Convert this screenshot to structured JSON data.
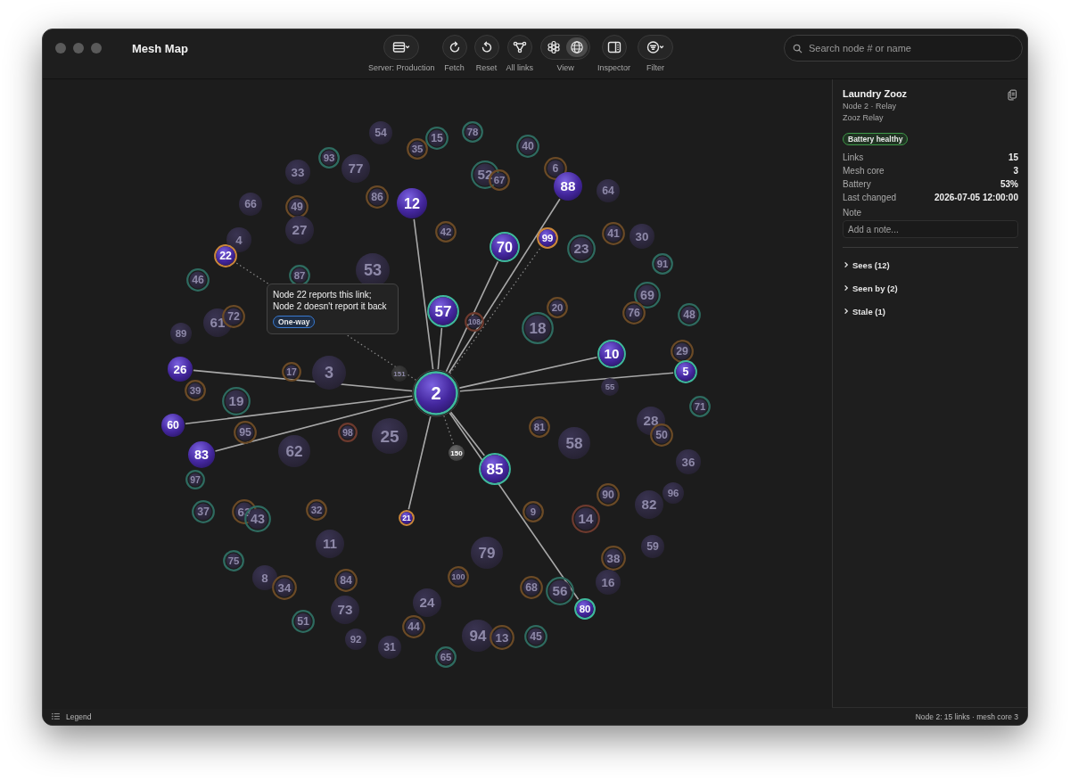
{
  "window": {
    "title": "Mesh Map"
  },
  "toolbar": {
    "items": [
      {
        "kind": "menu",
        "label": "Server: Production"
      },
      {
        "kind": "button",
        "label": "Fetch"
      },
      {
        "kind": "button",
        "label": "Reset"
      },
      {
        "kind": "button",
        "label": "All links"
      },
      {
        "kind": "segmented",
        "label": "View",
        "segments": [
          {
            "selected": false
          },
          {
            "selected": true
          }
        ]
      },
      {
        "kind": "button",
        "label": "Inspector"
      },
      {
        "kind": "menu",
        "label": "Filter"
      }
    ],
    "search": {
      "placeholder": "Search node # or name"
    }
  },
  "graph": {
    "nodes": [
      {
        "label": "78",
        "color": "#2e6b60",
        "offline": false,
        "selected": false
      },
      {
        "label": "54",
        "offline": false,
        "selected": false
      },
      {
        "label": "15",
        "color": "#2e6b60",
        "offline": false,
        "selected": false
      },
      {
        "label": "40",
        "color": "#2e6b60",
        "offline": false,
        "selected": false
      },
      {
        "label": "35",
        "color": "#6b4a26",
        "offline": false,
        "selected": false
      },
      {
        "label": "93",
        "color": "#2e6b60",
        "offline": false,
        "selected": false
      },
      {
        "label": "77",
        "offline": false,
        "selected": false
      },
      {
        "label": "6",
        "color": "#6b4a26",
        "offline": false,
        "selected": false
      },
      {
        "label": "33",
        "offline": false,
        "selected": false
      },
      {
        "label": "52",
        "color": "#2e6b60",
        "offline": false,
        "selected": false
      },
      {
        "label": "67",
        "color": "#6b4a26",
        "offline": false,
        "selected": false
      },
      {
        "label": "66",
        "offline": false,
        "selected": false
      },
      {
        "label": "49",
        "color": "#6b4a26",
        "offline": false,
        "selected": false
      },
      {
        "label": "86",
        "color": "#6b4a26",
        "offline": false,
        "selected": false
      },
      {
        "label": "12",
        "link": {
          "one_way": false
        },
        "offline": false,
        "selected": false
      },
      {
        "label": "88",
        "link": {
          "one_way": false
        },
        "offline": false,
        "selected": false
      },
      {
        "label": "64",
        "offline": false,
        "selected": false
      },
      {
        "label": "4",
        "offline": false,
        "selected": false
      },
      {
        "label": "27",
        "offline": false,
        "selected": false
      },
      {
        "label": "42",
        "color": "#6b4a26",
        "offline": false,
        "selected": false
      },
      {
        "label": "22",
        "color": "#c9863a",
        "link": {
          "one_way": true
        },
        "offline": false,
        "selected": false
      },
      {
        "label": "70",
        "color": "#3fb89c",
        "link": {
          "one_way": false
        },
        "offline": false,
        "selected": false
      },
      {
        "label": "99",
        "color": "#c9863a",
        "link": {
          "one_way": true
        },
        "offline": false,
        "selected": false
      },
      {
        "label": "23",
        "color": "#2e6b60",
        "offline": false,
        "selected": false
      },
      {
        "label": "41",
        "color": "#6b4a26",
        "offline": false,
        "selected": false
      },
      {
        "label": "30",
        "offline": false,
        "selected": false
      },
      {
        "label": "91",
        "color": "#2e6b60",
        "offline": false,
        "selected": false
      },
      {
        "label": "53",
        "offline": false,
        "selected": false
      },
      {
        "label": "87",
        "color": "#2e6b60",
        "offline": false,
        "selected": false
      },
      {
        "label": "46",
        "color": "#2e6b60",
        "offline": false,
        "selected": false
      },
      {
        "label": "69",
        "color": "#2e6b60",
        "offline": false,
        "selected": false
      },
      {
        "label": "89",
        "offline": false,
        "selected": false
      },
      {
        "label": "61",
        "offline": false,
        "selected": false
      },
      {
        "label": "72",
        "color": "#6b4a26",
        "offline": false,
        "selected": false
      },
      {
        "label": "57",
        "color": "#3fb89c",
        "link": {
          "one_way": false
        },
        "offline": false,
        "selected": false
      },
      {
        "label": "108",
        "color": "#6e3a2e",
        "offline": false,
        "selected": false
      },
      {
        "label": "18",
        "color": "#2e6b60",
        "offline": false,
        "selected": false
      },
      {
        "label": "20",
        "color": "#6b4a26",
        "offline": false,
        "selected": false
      },
      {
        "label": "76",
        "color": "#6b4a26",
        "offline": false,
        "selected": false
      },
      {
        "label": "48",
        "color": "#2e6b60",
        "offline": false,
        "selected": false
      },
      {
        "label": "10",
        "color": "#3fb89c",
        "link": {
          "one_way": false
        },
        "offline": false,
        "selected": false
      },
      {
        "label": "29",
        "color": "#6b4a26",
        "offline": false,
        "selected": false
      },
      {
        "label": "26",
        "link": {
          "one_way": false
        },
        "offline": false,
        "selected": false
      },
      {
        "label": "17",
        "color": "#6b4a26",
        "offline": false,
        "selected": false
      },
      {
        "label": "3",
        "offline": false,
        "selected": false
      },
      {
        "label": "151",
        "offline": true,
        "selected": false
      },
      {
        "label": "5",
        "color": "#3fb89c",
        "link": {
          "one_way": false
        },
        "offline": false,
        "selected": false
      },
      {
        "label": "39",
        "color": "#6b4a26",
        "offline": false,
        "selected": false
      },
      {
        "label": "19",
        "color": "#2e6b60",
        "offline": false,
        "selected": false
      },
      {
        "label": "2",
        "color": "#3fb89c",
        "offline": false,
        "selected": true
      },
      {
        "label": "55",
        "offline": false,
        "selected": false
      },
      {
        "label": "71",
        "color": "#2e6b60",
        "offline": false,
        "selected": false
      },
      {
        "label": "60",
        "link": {
          "one_way": false
        },
        "offline": false,
        "selected": false
      },
      {
        "label": "83",
        "link": {
          "one_way": false
        },
        "offline": false,
        "selected": false
      },
      {
        "label": "95",
        "color": "#6b4a26",
        "offline": false,
        "selected": false
      },
      {
        "label": "62",
        "offline": false,
        "selected": false
      },
      {
        "label": "98",
        "color": "#6e3a2e",
        "offline": false,
        "selected": false
      },
      {
        "label": "25",
        "offline": false,
        "selected": false
      },
      {
        "label": "150",
        "link": {
          "one_way": true
        },
        "offline": true,
        "selected": false
      },
      {
        "label": "85",
        "color": "#3fb89c",
        "link": {
          "one_way": false
        },
        "offline": false,
        "selected": false
      },
      {
        "label": "81",
        "color": "#6b4a26",
        "offline": false,
        "selected": false
      },
      {
        "label": "58",
        "offline": false,
        "selected": false
      },
      {
        "label": "28",
        "offline": false,
        "selected": false
      },
      {
        "label": "50",
        "color": "#6b4a26",
        "offline": false,
        "selected": false
      },
      {
        "label": "36",
        "offline": false,
        "selected": false
      },
      {
        "label": "97",
        "color": "#2e6b60",
        "offline": false,
        "selected": false
      },
      {
        "label": "90",
        "color": "#6b4a26",
        "offline": false,
        "selected": false
      },
      {
        "label": "96",
        "offline": false,
        "selected": false
      },
      {
        "label": "37",
        "color": "#2e6b60",
        "offline": false,
        "selected": false
      },
      {
        "label": "63",
        "color": "#6b4a26",
        "offline": false,
        "selected": false
      },
      {
        "label": "43",
        "color": "#2e6b60",
        "offline": false,
        "selected": false
      },
      {
        "label": "32",
        "color": "#6b4a26",
        "offline": false,
        "selected": false
      },
      {
        "label": "21",
        "color": "#c9863a",
        "link": {
          "one_way": false
        },
        "offline": false,
        "selected": false
      },
      {
        "label": "9",
        "color": "#6b4a26",
        "offline": false,
        "selected": false
      },
      {
        "label": "14",
        "color": "#6e3a2e",
        "offline": false,
        "selected": false
      },
      {
        "label": "82",
        "offline": false,
        "selected": false
      },
      {
        "label": "75",
        "color": "#2e6b60",
        "offline": false,
        "selected": false
      },
      {
        "label": "11",
        "offline": false,
        "selected": false
      },
      {
        "label": "79",
        "offline": false,
        "selected": false
      },
      {
        "label": "38",
        "color": "#6b4a26",
        "offline": false,
        "selected": false
      },
      {
        "label": "59",
        "offline": false,
        "selected": false
      },
      {
        "label": "8",
        "offline": false,
        "selected": false
      },
      {
        "label": "34",
        "color": "#6b4a26",
        "offline": false,
        "selected": false
      },
      {
        "label": "84",
        "color": "#6b4a26",
        "offline": false,
        "selected": false
      },
      {
        "label": "100",
        "color": "#6b4a26",
        "offline": false,
        "selected": false
      },
      {
        "label": "68",
        "color": "#6b4a26",
        "offline": false,
        "selected": false
      },
      {
        "label": "56",
        "color": "#2e6b60",
        "offline": false,
        "selected": false
      },
      {
        "label": "16",
        "offline": false,
        "selected": false
      },
      {
        "label": "73",
        "offline": false,
        "selected": false
      },
      {
        "label": "24",
        "offline": false,
        "selected": false
      },
      {
        "label": "80",
        "color": "#3fb89c",
        "link": {
          "one_way": false
        },
        "offline": false,
        "selected": false
      },
      {
        "label": "51",
        "color": "#2e6b60",
        "offline": false,
        "selected": false
      },
      {
        "label": "92",
        "offline": false,
        "selected": false
      },
      {
        "label": "44",
        "color": "#6b4a26",
        "offline": false,
        "selected": false
      },
      {
        "label": "94",
        "offline": false,
        "selected": false
      },
      {
        "label": "13",
        "color": "#6b4a26",
        "offline": false,
        "selected": false
      },
      {
        "label": "45",
        "color": "#2e6b60",
        "offline": false,
        "selected": false
      },
      {
        "label": "31",
        "offline": false,
        "selected": false
      },
      {
        "label": "65",
        "color": "#2e6b60",
        "offline": false,
        "selected": false
      }
    ],
    "tooltip": {
      "text": "Node 22 reports this link;\nNode 2 doesn't report it back",
      "badge": "One-way"
    }
  },
  "inspector": {
    "title": "Laundry Zooz",
    "subtitle": "Node 2 · Relay",
    "model": "Zooz Relay",
    "badge": "Battery healthy",
    "fields": [
      {
        "label": "Links",
        "value": "15"
      },
      {
        "label": "Mesh core",
        "value": "3"
      },
      {
        "label": "Battery",
        "value": "53%"
      },
      {
        "label": "Last changed",
        "value": "2026-07-05 12:00:00"
      }
    ],
    "note": {
      "label": "Note",
      "placeholder": "Add a note..."
    },
    "sections": [
      {
        "label": "Sees (12)",
        "expanded": false
      },
      {
        "label": "Seen by (2)",
        "expanded": false
      },
      {
        "label": "Stale (1)",
        "expanded": false
      }
    ]
  },
  "status_bar": {
    "left": "Legend",
    "right": "Node 2: 15 links · mesh core 3"
  }
}
